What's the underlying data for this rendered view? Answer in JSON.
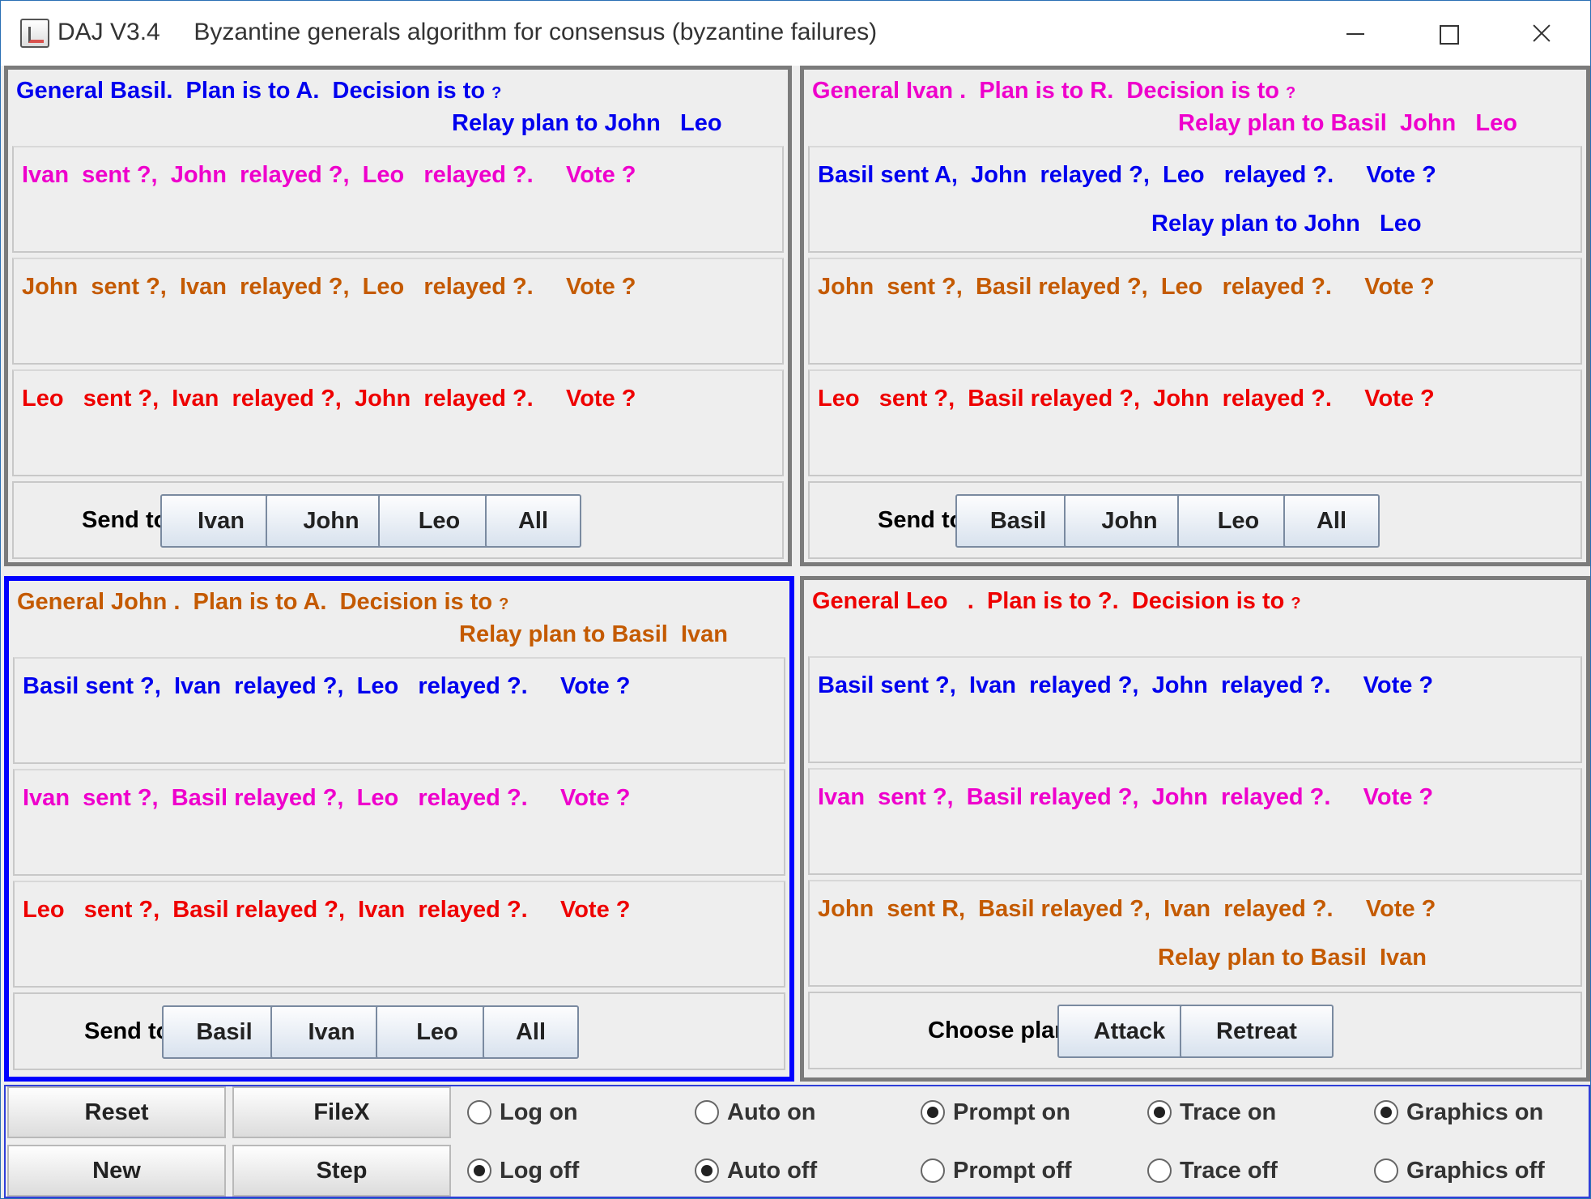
{
  "window": {
    "title": "DAJ V3.4     Byzantine generals algorithm for consensus (byzantine failures)",
    "controls": [
      "minimize",
      "maximize",
      "close"
    ]
  },
  "colors": {
    "basil": "#0000ee",
    "ivan": "#ee00cc",
    "john": "#c45a00",
    "leo": "#ee0000",
    "active_border": "#0000ff"
  },
  "generals": {
    "basil": {
      "header": "General Basil.  Plan is to A.  Decision is to",
      "header_q": "?",
      "relay": "Relay plan to John   Leo",
      "rows": [
        {
          "text": "Ivan  sent ?,  John  relayed ?,  Leo   relayed ?.     Vote ?"
        },
        {
          "text": "John  sent ?,  Ivan  relayed ?,  Leo   relayed ?.     Vote ?"
        },
        {
          "text": "Leo   sent ?,  Ivan  relayed ?,  John  relayed ?.     Vote ?"
        }
      ],
      "send_label": "Send to",
      "buttons": [
        "Ivan",
        "John",
        "Leo",
        "All"
      ]
    },
    "ivan": {
      "header": "General Ivan .  Plan is to R.  Decision is to",
      "header_q": "?",
      "relay": "Relay plan to Basil  John   Leo",
      "rows": [
        {
          "text": "Basil sent A,  John  relayed ?,  Leo   relayed ?.     Vote ?",
          "relay": "Relay plan to John   Leo"
        },
        {
          "text": "John  sent ?,  Basil relayed ?,  Leo   relayed ?.     Vote ?"
        },
        {
          "text": "Leo   sent ?,  Basil relayed ?,  John  relayed ?.     Vote ?"
        }
      ],
      "send_label": "Send to",
      "buttons": [
        "Basil",
        "John",
        "Leo",
        "All"
      ]
    },
    "john": {
      "header": "General John .  Plan is to A.  Decision is to",
      "header_q": "?",
      "relay": "Relay plan to Basil  Ivan",
      "rows": [
        {
          "text": "Basil sent ?,  Ivan  relayed ?,  Leo   relayed ?.     Vote ?"
        },
        {
          "text": "Ivan  sent ?,  Basil relayed ?,  Leo   relayed ?.     Vote ?"
        },
        {
          "text": "Leo   sent ?,  Basil relayed ?,  Ivan  relayed ?.     Vote ?"
        }
      ],
      "send_label": "Send to",
      "buttons": [
        "Basil",
        "Ivan",
        "Leo",
        "All"
      ]
    },
    "leo": {
      "header": "General Leo   .  Plan is to ?.  Decision is to",
      "header_q": "?",
      "rows": [
        {
          "text": "Basil sent ?,  Ivan  relayed ?,  John  relayed ?.     Vote ?"
        },
        {
          "text": "Ivan  sent ?,  Basil relayed ?,  John  relayed ?.     Vote ?"
        },
        {
          "text": "John  sent R,  Basil relayed ?,  Ivan  relayed ?.     Vote ?",
          "relay": "Relay plan to Basil  Ivan"
        }
      ],
      "choose_label": "Choose plan",
      "buttons": [
        "Attack",
        "Retreat"
      ]
    }
  },
  "controls": {
    "buttons": [
      "Reset",
      "FileX",
      "New",
      "Step"
    ],
    "radios": [
      {
        "label": "Log on",
        "selected": false
      },
      {
        "label": "Log off",
        "selected": true
      },
      {
        "label": "Auto on",
        "selected": false
      },
      {
        "label": "Auto off",
        "selected": true
      },
      {
        "label": "Prompt on",
        "selected": true
      },
      {
        "label": "Prompt off",
        "selected": false
      },
      {
        "label": "Trace on",
        "selected": true
      },
      {
        "label": "Trace off",
        "selected": false
      },
      {
        "label": "Graphics on",
        "selected": true
      },
      {
        "label": "Graphics off",
        "selected": false
      }
    ]
  }
}
